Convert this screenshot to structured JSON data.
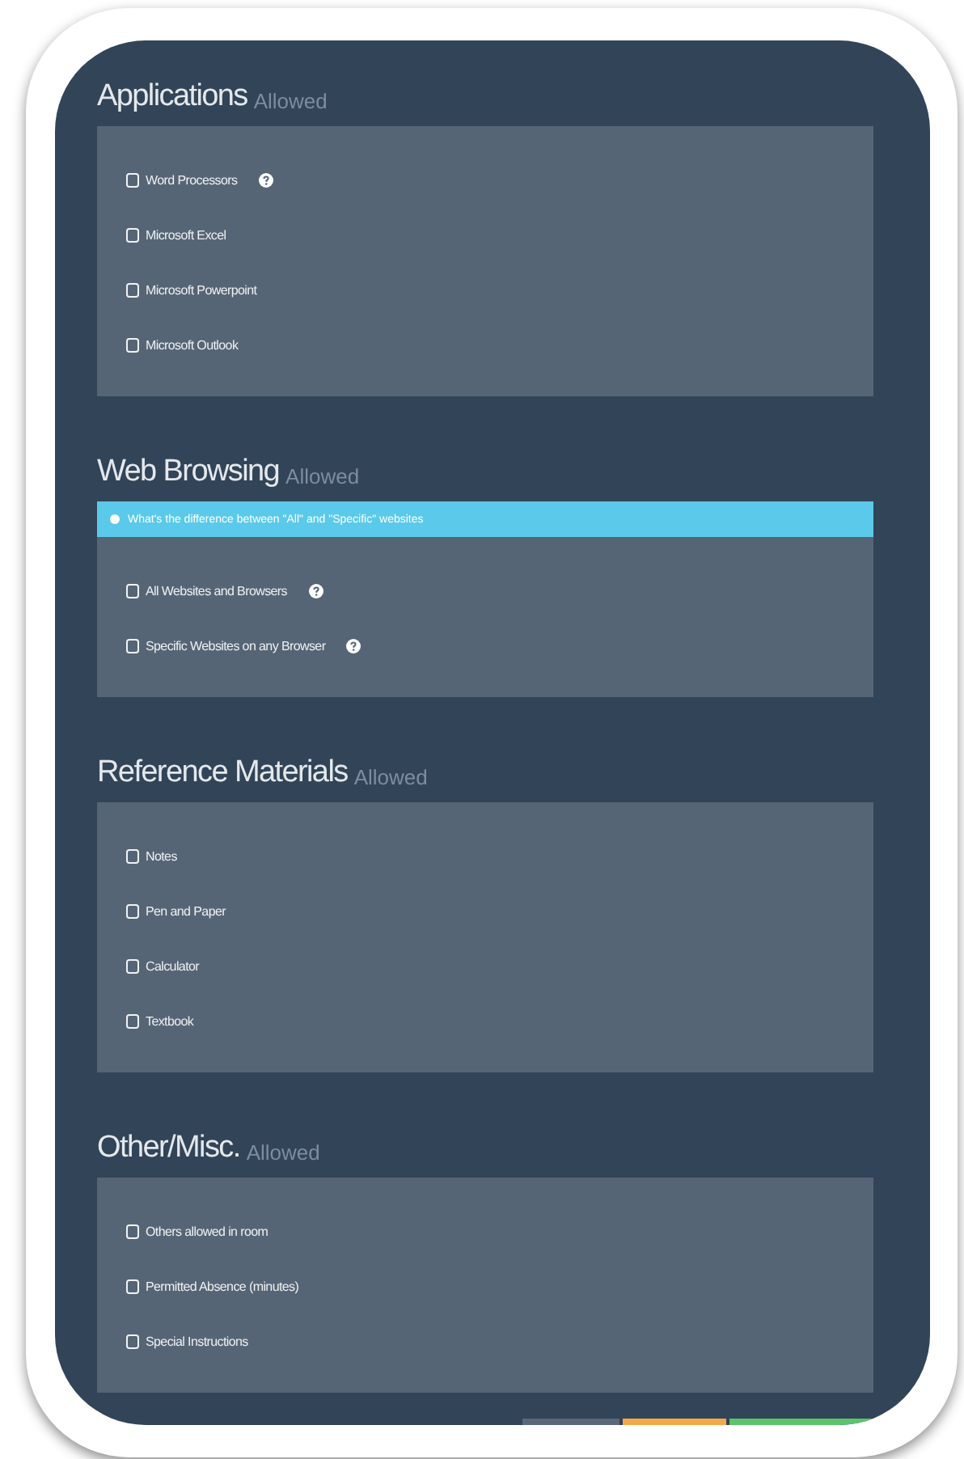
{
  "sections": [
    {
      "title": "Applications",
      "badge": "Allowed",
      "items": [
        {
          "label": "Word Processors",
          "checked": false,
          "help": true
        },
        {
          "label": "Microsoft Excel",
          "checked": false,
          "help": false
        },
        {
          "label": "Microsoft Powerpoint",
          "checked": false,
          "help": false
        },
        {
          "label": "Microsoft Outlook",
          "checked": false,
          "help": false
        }
      ]
    },
    {
      "title": "Web Browsing",
      "badge": "Allowed",
      "notice": "What's the difference between \"All\" and \"Specific\" websites",
      "items": [
        {
          "label": "All Websites and Browsers",
          "checked": false,
          "help": true
        },
        {
          "label": "Specific Websites on any Browser",
          "checked": false,
          "help": true
        }
      ]
    },
    {
      "title": "Reference Materials",
      "badge": "Allowed",
      "items": [
        {
          "label": "Notes",
          "checked": false,
          "help": false
        },
        {
          "label": "Pen and Paper",
          "checked": false,
          "help": false
        },
        {
          "label": "Calculator",
          "checked": false,
          "help": false
        },
        {
          "label": "Textbook",
          "checked": false,
          "help": false
        }
      ]
    },
    {
      "title": "Other/Misc.",
      "badge": "Allowed",
      "items": [
        {
          "label": "Others allowed in room",
          "checked": false,
          "help": false
        },
        {
          "label": "Permitted Absence (minutes)",
          "checked": false,
          "help": false
        },
        {
          "label": "Special Instructions",
          "checked": false,
          "help": false
        }
      ]
    }
  ]
}
